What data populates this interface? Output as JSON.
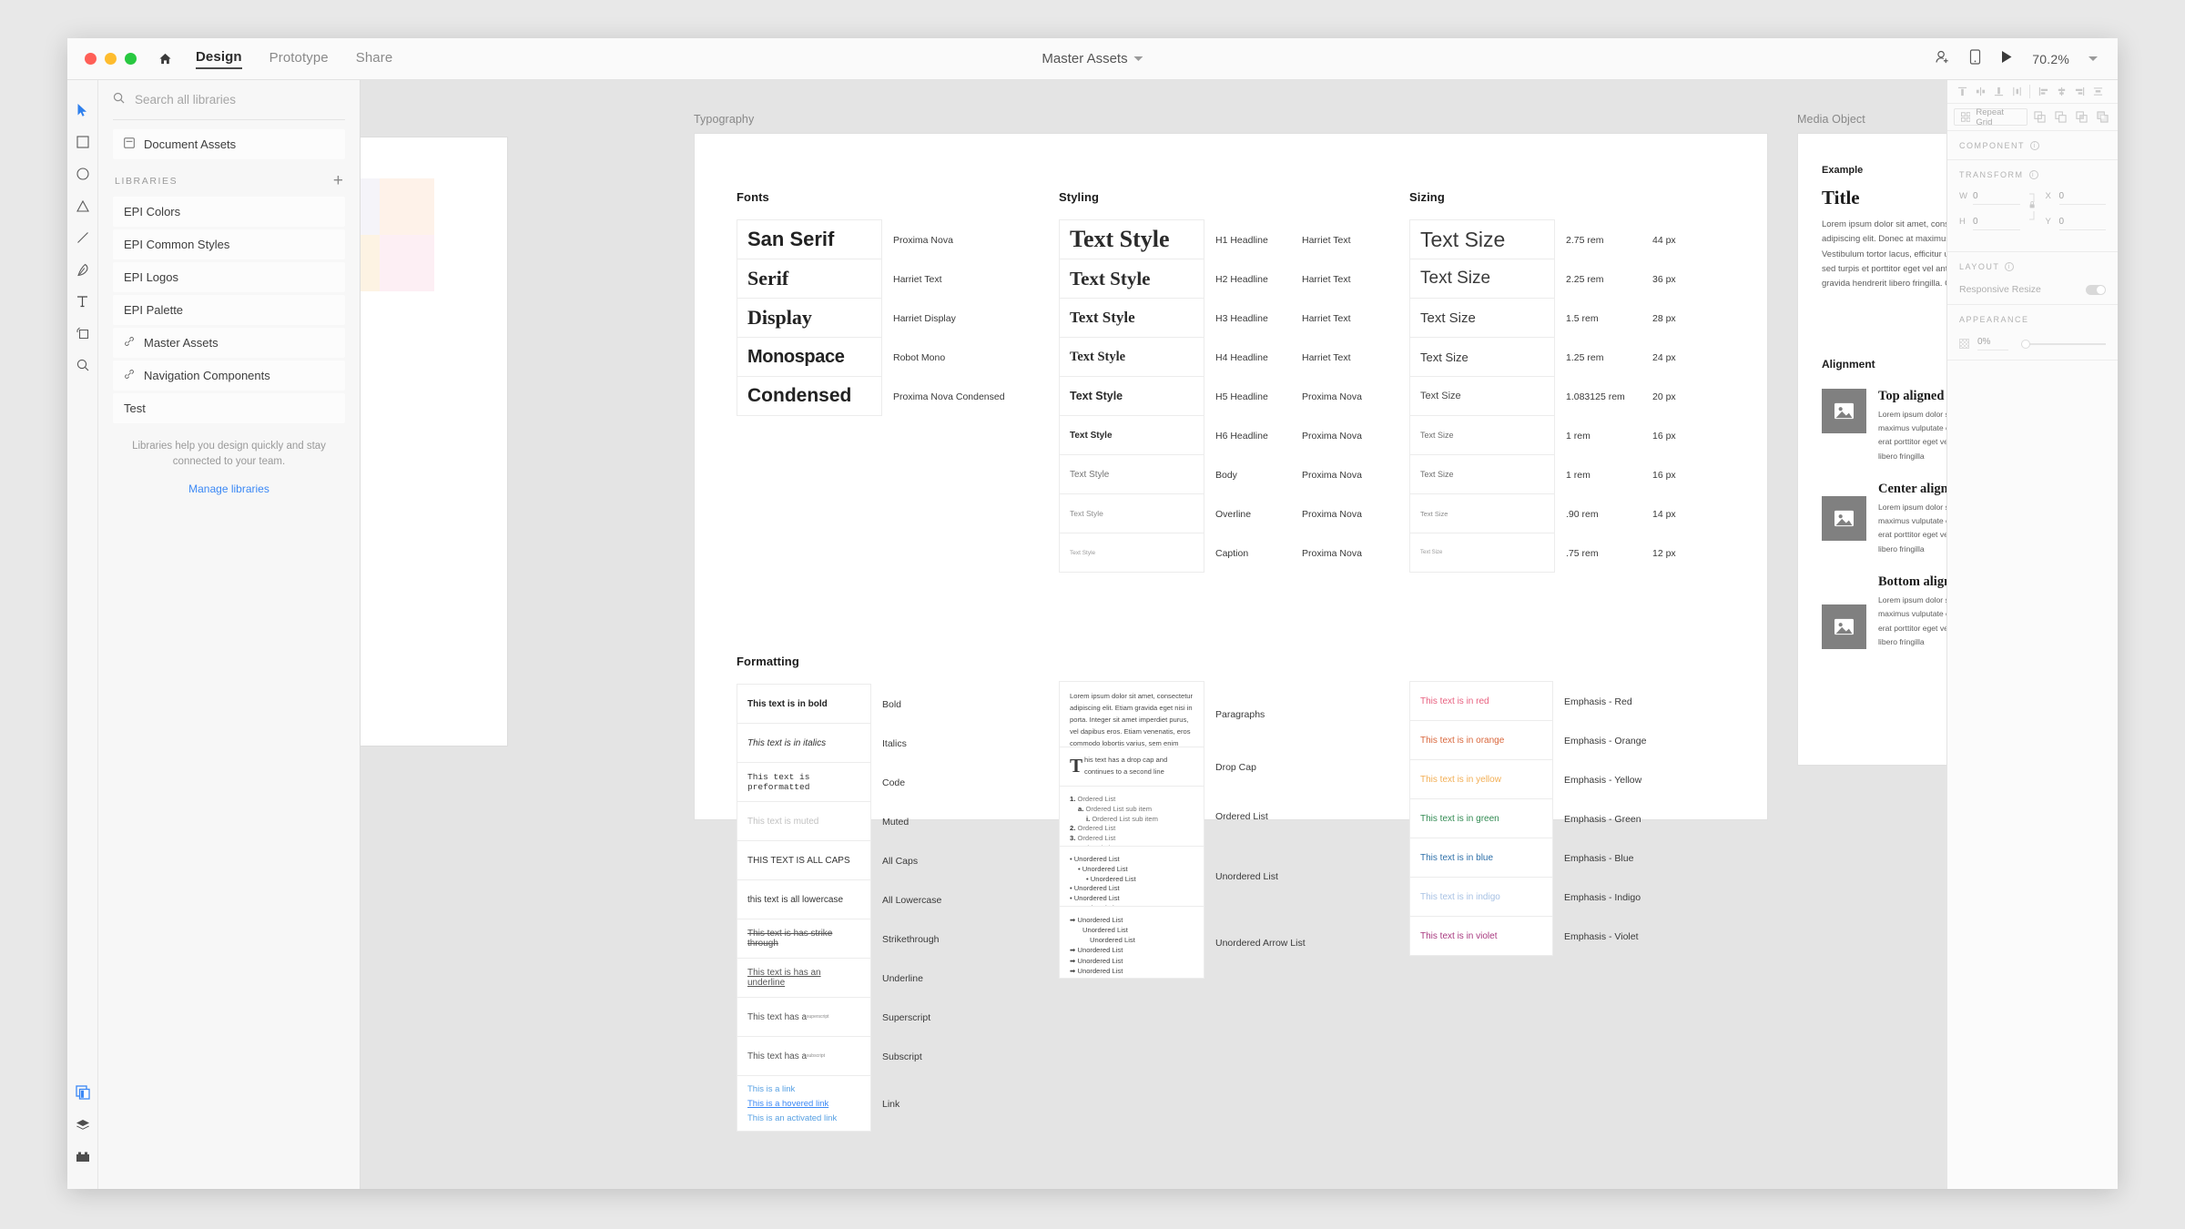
{
  "window": {
    "traffic_lights": [
      "close",
      "minimize",
      "maximize"
    ],
    "menu_tabs": [
      {
        "label": "Design",
        "active": true
      },
      {
        "label": "Prototype",
        "active": false
      },
      {
        "label": "Share",
        "active": false
      }
    ],
    "document_title": "Master Assets",
    "zoom_level": "70.2%",
    "right_icons": [
      "add-collaborator-icon",
      "device-preview-icon",
      "play-icon"
    ]
  },
  "tool_rail": {
    "tools": [
      "select-tool",
      "rectangle-tool",
      "ellipse-tool",
      "polygon-tool",
      "line-tool",
      "pen-tool",
      "text-tool",
      "artboard-tool",
      "zoom-tool"
    ],
    "bottom_tools": [
      "assets-panel-icon",
      "layers-panel-icon",
      "plugins-icon"
    ]
  },
  "libraries_panel": {
    "search": {
      "placeholder": "Search all libraries",
      "value": ""
    },
    "document_assets": "Document Assets",
    "section_title": "LIBRARIES",
    "add_label": "+",
    "items": [
      {
        "label": "EPI Colors",
        "linked": false
      },
      {
        "label": "EPI Common Styles",
        "linked": false
      },
      {
        "label": "EPI Logos",
        "linked": false
      },
      {
        "label": "EPI Palette",
        "linked": false
      },
      {
        "label": "Master Assets",
        "linked": true
      },
      {
        "label": "Navigation Components",
        "linked": true
      },
      {
        "label": "Test",
        "linked": false
      }
    ],
    "help_text": "Libraries help you design quickly and stay connected to your team.",
    "manage_link": "Manage libraries"
  },
  "canvas": {
    "artboards": [
      {
        "name": "Typography"
      },
      {
        "name": "Media Object"
      }
    ]
  },
  "typography": {
    "fonts": {
      "title": "Fonts",
      "rows": [
        {
          "sample": "San Serif",
          "font": "Proxima Nova"
        },
        {
          "sample": "Serif",
          "font": "Harriet Text"
        },
        {
          "sample": "Display",
          "font": "Harriet Display"
        },
        {
          "sample": "Monospace",
          "font": "Robot Mono"
        },
        {
          "sample": "Condensed",
          "font": "Proxima Nova Condensed"
        }
      ]
    },
    "styling": {
      "title": "Styling",
      "rows": [
        {
          "sample": "Text Style",
          "style": "H1 Headline",
          "font": "Harriet Text"
        },
        {
          "sample": "Text Style",
          "style": "H2 Headline",
          "font": "Harriet Text"
        },
        {
          "sample": "Text Style",
          "style": "H3 Headline",
          "font": "Harriet Text"
        },
        {
          "sample": "Text Style",
          "style": "H4 Headline",
          "font": "Harriet Text"
        },
        {
          "sample": "Text Style",
          "style": "H5 Headline",
          "font": "Proxima Nova"
        },
        {
          "sample": "Text Style",
          "style": "H6 Headline",
          "font": "Proxima Nova"
        },
        {
          "sample": "Text Style",
          "style": "Body",
          "font": "Proxima Nova"
        },
        {
          "sample": "Text Style",
          "style": "Overline",
          "font": "Proxima Nova"
        },
        {
          "sample": "Text Style",
          "style": "Caption",
          "font": "Proxima Nova"
        }
      ]
    },
    "sizing": {
      "title": "Sizing",
      "rows": [
        {
          "sample": "Text Size",
          "rem": "2.75 rem",
          "px": "44 px"
        },
        {
          "sample": "Text Size",
          "rem": "2.25 rem",
          "px": "36 px"
        },
        {
          "sample": "Text Size",
          "rem": "1.5 rem",
          "px": "28 px"
        },
        {
          "sample": "Text Size",
          "rem": "1.25 rem",
          "px": "24 px"
        },
        {
          "sample": "Text Size",
          "rem": "1.083125 rem",
          "px": "20 px"
        },
        {
          "sample": "Text Size",
          "rem": "1 rem",
          "px": "16 px"
        },
        {
          "sample": "Text Size",
          "rem": "1 rem",
          "px": "16 px"
        },
        {
          "sample": "Text Size",
          "rem": ".90 rem",
          "px": "14 px"
        },
        {
          "sample": "Text Size",
          "rem": ".75 rem",
          "px": "12 px"
        }
      ]
    },
    "formatting": {
      "title": "Formatting",
      "rows": [
        {
          "sample": "This text is in bold",
          "label": "Bold"
        },
        {
          "sample": "This text is in italics",
          "label": "Italics"
        },
        {
          "sample": "This text is preformatted",
          "label": "Code"
        },
        {
          "sample": "This text is muted",
          "label": "Muted"
        },
        {
          "sample": "THIS TEXT IS ALL CAPS",
          "label": "All Caps"
        },
        {
          "sample": "this text is all lowercase",
          "label": "All Lowercase"
        },
        {
          "sample": "This text is has strike through",
          "label": "Strikethrough"
        },
        {
          "sample": "This text is has an underline",
          "label": "Underline"
        },
        {
          "sample": "This text has a ",
          "sup": "superscript",
          "label": "Superscript"
        },
        {
          "sample": "This text has a ",
          "sub": "subscript",
          "label": "Subscript"
        },
        {
          "links": [
            "This is a link",
            "This is a hovered link",
            "This is an activated link"
          ],
          "label": "Link"
        }
      ]
    },
    "blocks": {
      "paragraph": {
        "text": "Lorem ipsum dolor sit amet, consectetur adipiscing elit. Etiam gravida eget nisi in porta. Integer sit amet imperdiet purus, vel dapibus eros. Etiam venenatis, eros commodo lobortis varius, sem enim finibus nisi, eu porttitor nisl eros",
        "label": "Paragraphs"
      },
      "dropcap": {
        "cap": "T",
        "text": "his text has a drop cap and continues to a second line",
        "label": "Drop Cap"
      },
      "ordered_list": {
        "label": "Ordered List",
        "items": [
          {
            "marker": "1.",
            "text": "Ordered List",
            "level": 0
          },
          {
            "marker": "a.",
            "text": "Ordered List sub item",
            "level": 1
          },
          {
            "marker": "i.",
            "text": "Ordered List sub item",
            "level": 2
          },
          {
            "marker": "2.",
            "text": "Ordered List",
            "level": 0
          },
          {
            "marker": "3.",
            "text": "Ordered List",
            "level": 0
          },
          {
            "marker": "4.",
            "text": "Ordered List",
            "level": 0
          }
        ]
      },
      "unordered_list": {
        "label": "Unordered List",
        "items": [
          {
            "marker": "•",
            "text": "Unordered List",
            "level": 0
          },
          {
            "marker": "•",
            "text": "Unordered List",
            "level": 1
          },
          {
            "marker": "•",
            "text": "Unordered List",
            "level": 2
          },
          {
            "marker": "•",
            "text": "Unordered List",
            "level": 0
          },
          {
            "marker": "•",
            "text": "Unordered List",
            "level": 0
          },
          {
            "marker": "•",
            "text": "Unordered List",
            "level": 0
          }
        ]
      },
      "arrow_list": {
        "label": "Unordered Arrow List",
        "items": [
          {
            "marker": "➡",
            "text": "Unordered List",
            "level": 0
          },
          {
            "marker": "",
            "text": "Unordered List",
            "level": 1
          },
          {
            "marker": "",
            "text": "Unordered List",
            "level": 2
          },
          {
            "marker": "➡",
            "text": "Unordered List",
            "level": 0
          },
          {
            "marker": "➡",
            "text": "Unordered List",
            "level": 0
          },
          {
            "marker": "➡",
            "text": "Unordered List",
            "level": 0
          }
        ]
      }
    },
    "emphasis": {
      "rows": [
        {
          "sample": "This text is in red",
          "label": "Emphasis - Red",
          "color": "#e8607f"
        },
        {
          "sample": "This text is in orange",
          "label": "Emphasis - Orange",
          "color": "#d9673c"
        },
        {
          "sample": "This text is in yellow",
          "label": "Emphasis - Yellow",
          "color": "#f2ae54"
        },
        {
          "sample": "This text is in green",
          "label": "Emphasis - Green",
          "color": "#318a52"
        },
        {
          "sample": "This text is in blue",
          "label": "Emphasis - Blue",
          "color": "#2d6fa8"
        },
        {
          "sample": "This text is in indigo",
          "label": "Emphasis - Indigo",
          "color": "#a8c2e4"
        },
        {
          "sample": "This text is in violet",
          "label": "Emphasis - Violet",
          "color": "#a8387f"
        }
      ]
    }
  },
  "media_object": {
    "example_label": "Example",
    "title": "Title",
    "paragraph": "Lorem ipsum dolor sit amet, consectetur adipiscing elit. Donec at maximus vulputate. Vestibulum tortor lacus, efficitur ut. Sed id erat sed turpis et porttitor eget vel ante. Praesent gravida hendrerit libero fringilla. Cras sodales",
    "alignment_title": "Alignment",
    "items": [
      {
        "heading": "Top aligned",
        "body": "Lorem ipsum dolor sit amet at maximus vulputate efficitur ut. Sed id erat porttitor eget vel ante hendrerit libero fringilla"
      },
      {
        "heading": "Center aligned",
        "body": "Lorem ipsum dolor sit amet at maximus vulputate efficitur ut. Sed id erat porttitor eget vel ante hendrerit libero fringilla"
      },
      {
        "heading": "Bottom aligned",
        "body": "Lorem ipsum dolor sit amet at maximus vulputate efficitur ut. Sed id erat porttitor eget vel ante hendrerit libero fringilla"
      }
    ]
  },
  "inspector": {
    "align_icons_group1": [
      "align-top-icon",
      "align-vertical-center-icon",
      "align-bottom-icon",
      "distribute-vertical-icon"
    ],
    "align_icons_group2": [
      "align-left-icon",
      "align-horizontal-center-icon",
      "align-right-icon",
      "distribute-horizontal-icon"
    ],
    "repeat_grid_label": "Repeat Grid",
    "boolean_icons": [
      "union-icon",
      "subtract-icon",
      "intersect-icon",
      "exclude-icon"
    ],
    "sections": {
      "component": {
        "title": "COMPONENT"
      },
      "transform": {
        "title": "TRANSFORM",
        "w_key": "W",
        "w_value": "0",
        "h_key": "H",
        "h_value": "0",
        "x_key": "X",
        "x_value": "0",
        "y_key": "Y",
        "y_value": "0"
      },
      "layout": {
        "title": "LAYOUT",
        "responsive_resize_label": "Responsive Resize",
        "responsive_resize_on": true
      },
      "appearance": {
        "title": "APPEARANCE",
        "opacity": "0%"
      }
    }
  }
}
